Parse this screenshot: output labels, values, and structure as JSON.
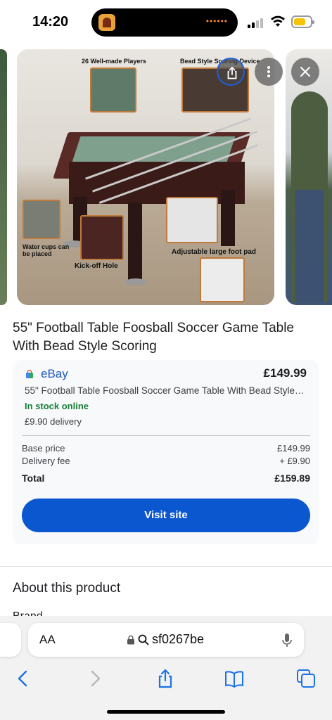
{
  "status_bar": {
    "time": "14:20",
    "island_indicator": "••••••",
    "battery_color": "#f5c400"
  },
  "carousel": {
    "image_labels": {
      "players": "26 Well-made Players",
      "scoring": "Bead Style Scoring Device",
      "cups": "Water cups can be placed",
      "kickoff": "Kick-off Hole",
      "footpad": "Adjustable large foot pad"
    },
    "buttons": {
      "share_icon": "share-icon",
      "more_icon": "more-vertical-icon",
      "close_icon": "close-icon"
    }
  },
  "product": {
    "title": "55\" Football Table Foosball Soccer Game Table With Bead Style Scoring"
  },
  "offer": {
    "merchant": "eBay",
    "price": "£149.99",
    "description": "55\" Football Table Foosball Soccer Game Table With Bead Style…",
    "stock": "In stock online",
    "delivery": "£9.90 delivery",
    "breakdown": {
      "base_label": "Base price",
      "base_value": "£149.99",
      "fee_label": "Delivery fee",
      "fee_value": "+ £9.90",
      "total_label": "Total",
      "total_value": "£159.89"
    },
    "visit_label": "Visit site",
    "accent_color": "#0b57d0",
    "stock_color": "#188038"
  },
  "about": {
    "heading": "About this product",
    "peek": "Brand"
  },
  "browser": {
    "aa_label": "AA",
    "url": "sf0267be",
    "nav": {
      "back_icon": "chevron-left-icon",
      "forward_icon": "chevron-right-icon",
      "share_icon": "share-icon",
      "bookmarks_icon": "book-icon",
      "tabs_icon": "tabs-icon"
    }
  }
}
